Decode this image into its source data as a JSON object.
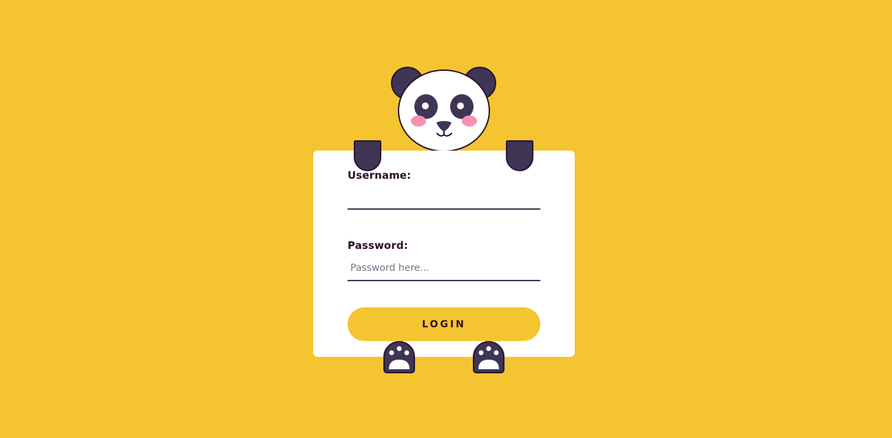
{
  "colors": {
    "background": "#f4c531",
    "card": "#ffffff",
    "panda_dark": "#3f3554",
    "outline": "#2b1330",
    "blush": "#f88fb0",
    "text": "#2e0f2a"
  },
  "illustration": {
    "face_icon": "panda-face-icon",
    "hand_icon": "panda-hand-icon",
    "paw_icon": "panda-paw-icon"
  },
  "form": {
    "username": {
      "label": "Username:",
      "value": "",
      "placeholder": ""
    },
    "password": {
      "label": "Password:",
      "value": "",
      "placeholder": "Password here..."
    },
    "login_label": "LOGIN"
  }
}
